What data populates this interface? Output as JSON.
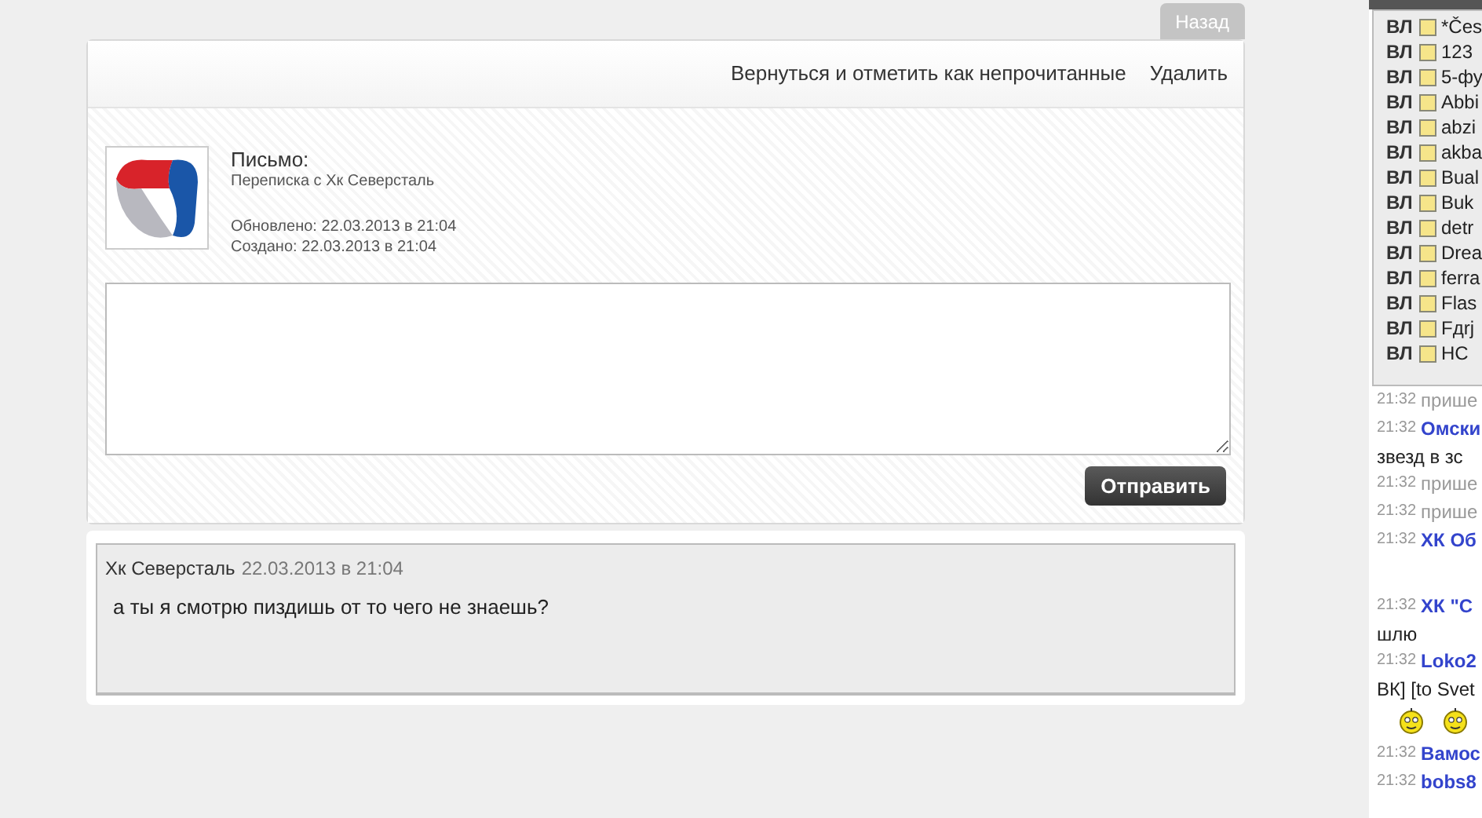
{
  "back_tab": "Назад",
  "toolbar": {
    "actions": [
      "Вернуться и отметить как непрочитанные",
      "Удалить"
    ]
  },
  "letter": {
    "title": "Письмо:",
    "subtitle": "Переписка с Хк Северсталь",
    "updated": "Обновлено: 22.03.2013 в 21:04",
    "created": "Создано: 22.03.2013 в 21:04"
  },
  "reply": {
    "send_button": "Отправить"
  },
  "message": {
    "author": "Хк Северсталь",
    "date": "22.03.2013 в 21:04",
    "text": "а ты я смотрю пиздишь от то чего не знаешь?"
  },
  "dropdown": [
    {
      "prefix": "ВЛ",
      "name": "*Čes"
    },
    {
      "prefix": "ВЛ",
      "name": "123"
    },
    {
      "prefix": "ВЛ",
      "name": "5-фу"
    },
    {
      "prefix": "ВЛ",
      "name": "Abbi"
    },
    {
      "prefix": "ВЛ",
      "name": "abzi"
    },
    {
      "prefix": "ВЛ",
      "name": "akba"
    },
    {
      "prefix": "ВЛ",
      "name": "Bual"
    },
    {
      "prefix": "ВЛ",
      "name": "Buk"
    },
    {
      "prefix": "ВЛ",
      "name": "detr"
    },
    {
      "prefix": "ВЛ",
      "name": "Drea"
    },
    {
      "prefix": "ВЛ",
      "name": "ferra"
    },
    {
      "prefix": "ВЛ",
      "name": "Flas"
    },
    {
      "prefix": "ВЛ",
      "name": "Fдrj"
    },
    {
      "prefix": "ВЛ",
      "name": "HC"
    }
  ],
  "chat": [
    {
      "kind": "system",
      "time": "21:32",
      "text": "прише"
    },
    {
      "kind": "user",
      "time": "21:32",
      "text": "Омски"
    },
    {
      "kind": "text",
      "text": "звезд в зс"
    },
    {
      "kind": "system",
      "time": "21:32",
      "text": "прише"
    },
    {
      "kind": "system",
      "time": "21:32",
      "text": "прише"
    },
    {
      "kind": "user",
      "time": "21:32",
      "text": "ХК Об"
    },
    {
      "kind": "gap"
    },
    {
      "kind": "user",
      "time": "21:32",
      "text": "ХК \"С"
    },
    {
      "kind": "text",
      "text": "шлю"
    },
    {
      "kind": "user",
      "time": "21:32",
      "text": "Loko2"
    },
    {
      "kind": "text",
      "text": "ВК] [to Svet"
    },
    {
      "kind": "smileys"
    },
    {
      "kind": "user",
      "time": "21:32",
      "text": "Вамос"
    },
    {
      "kind": "user",
      "time": "21:32",
      "text": "bobs8"
    }
  ]
}
